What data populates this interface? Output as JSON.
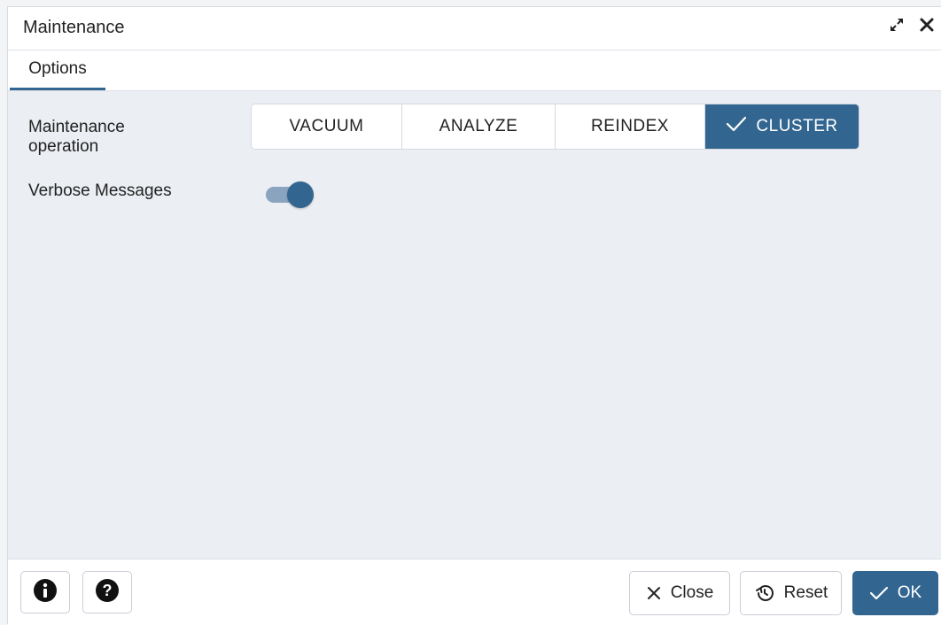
{
  "dialog": {
    "title": "Maintenance",
    "title_icons": [
      "expand-icon",
      "close-icon"
    ]
  },
  "tabs": [
    {
      "label": "Options",
      "active": true
    }
  ],
  "form": {
    "operation_label_line1": "Maintenance",
    "operation_label_line2": "operation",
    "operations": [
      {
        "label": "VACUUM",
        "selected": false
      },
      {
        "label": "ANALYZE",
        "selected": false
      },
      {
        "label": "REINDEX",
        "selected": false
      },
      {
        "label": "CLUSTER",
        "selected": true
      }
    ],
    "verbose_label": "Verbose Messages",
    "verbose_on": true
  },
  "footer": {
    "info_icon": "info-icon",
    "help_icon": "help-icon",
    "close_label": "Close",
    "reset_label": "Reset",
    "ok_label": "OK"
  },
  "colors": {
    "accent": "#326690",
    "content_bg": "#ebeef3",
    "toggle_track": "#8aa3bf"
  }
}
